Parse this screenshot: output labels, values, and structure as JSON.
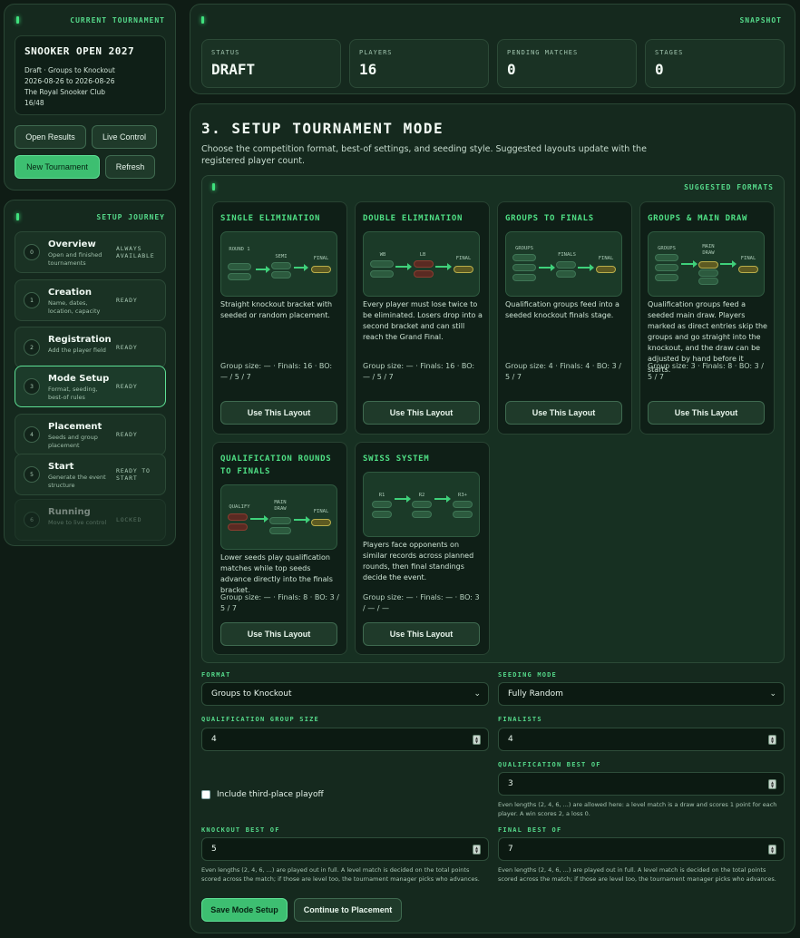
{
  "current": {
    "kicker": "CURRENT TOURNAMENT",
    "name": "SNOOKER OPEN 2027",
    "lines": [
      "Draft · Groups to Knockout",
      "2026-08-26 to 2026-08-26",
      "The Royal Snooker Club",
      "16/48"
    ],
    "buttons": {
      "open": "Open Results",
      "live": "Live Control",
      "new": "New Tournament",
      "refresh": "Refresh"
    }
  },
  "journey": {
    "kicker": "SETUP JOURNEY",
    "steps": [
      {
        "num": "0",
        "name": "Overview",
        "desc": "Open and finished tournaments",
        "status": "ALWAYS AVAILABLE"
      },
      {
        "num": "1",
        "name": "Creation",
        "desc": "Name, dates, location, capacity",
        "status": "READY"
      },
      {
        "num": "2",
        "name": "Registration",
        "desc": "Add the player field",
        "status": "READY"
      },
      {
        "num": "3",
        "name": "Mode Setup",
        "desc": "Format, seeding, best-of rules",
        "status": "READY"
      },
      {
        "num": "4",
        "name": "Placement",
        "desc": "Seeds and group placement",
        "status": "READY"
      },
      {
        "num": "5",
        "name": "Start",
        "desc": "Generate the event structure",
        "status": "READY TO START"
      },
      {
        "num": "6",
        "name": "Running",
        "desc": "Move to live control",
        "status": "LOCKED"
      }
    ]
  },
  "snapshot": {
    "kicker": "SNAPSHOT",
    "stats": [
      {
        "label": "STATUS",
        "value": "DRAFT"
      },
      {
        "label": "PLAYERS",
        "value": "16"
      },
      {
        "label": "PENDING MATCHES",
        "value": "0"
      },
      {
        "label": "STAGES",
        "value": "0"
      }
    ]
  },
  "mode": {
    "title": "3. SETUP TOURNAMENT MODE",
    "intro": "Choose the competition format, best-of settings, and seeding style. Suggested layouts update with the registered player count.",
    "suggested_kicker": "SUGGESTED FORMATS",
    "use_label": "Use This Layout",
    "formats": [
      {
        "title": "SINGLE ELIMINATION",
        "desc": "Straight knockout bracket with seeded or random placement.",
        "meta": "Group size: — · Finals: 16 · BO: — / 5 / 7",
        "d": [
          "ROUND 1",
          "SEMI",
          "FINAL"
        ]
      },
      {
        "title": "DOUBLE ELIMINATION",
        "desc": "Every player must lose twice to be eliminated. Losers drop into a second bracket and can still reach the Grand Final.",
        "meta": "Group size: — · Finals: 16 · BO: — / 5 / 7",
        "d": [
          "WB",
          "LB",
          "FINAL"
        ]
      },
      {
        "title": "GROUPS TO FINALS",
        "desc": "Qualification groups feed into a seeded knockout finals stage.",
        "meta": "Group size: 4 · Finals: 4 · BO: 3 / 5 / 7",
        "d": [
          "GROUPS",
          "FINALS",
          "FINAL"
        ]
      },
      {
        "title": "GROUPS & MAIN DRAW",
        "desc": "Qualification groups feed a seeded main draw. Players marked as direct entries skip the groups and go straight into the knockout, and the draw can be adjusted by hand before it starts.",
        "meta": "Group size: 3 · Finals: 8 · BO: 3 / 5 / 7",
        "d": [
          "GROUPS",
          "MAIN DRAW",
          "FINAL"
        ]
      },
      {
        "title": "QUALIFICATION ROUNDS TO FINALS",
        "desc": "Lower seeds play qualification matches while top seeds advance directly into the finals bracket.",
        "meta": "Group size: — · Finals: 8 · BO: 3 / 5 / 7",
        "d": [
          "QUALIFY",
          "MAIN DRAW",
          "FINAL"
        ]
      },
      {
        "title": "SWISS SYSTEM",
        "desc": "Players face opponents on similar records across planned rounds, then final standings decide the event.",
        "meta": "Group size: — · Finals: — · BO: 3 / — / —",
        "d": [
          "R1",
          "R2",
          "R3+"
        ]
      }
    ]
  },
  "form": {
    "format": {
      "label": "FORMAT",
      "value": "Groups to Knockout"
    },
    "seeding": {
      "label": "SEEDING MODE",
      "value": "Fully Random"
    },
    "qgs": {
      "label": "QUALIFICATION GROUP SIZE",
      "value": "4"
    },
    "finalists": {
      "label": "FINALISTS",
      "value": "4"
    },
    "qbo": {
      "label": "QUALIFICATION BEST OF",
      "value": "3",
      "help": "Even lengths (2, 4, 6, ...) are allowed here: a level match is a draw and scores 1 point for each player. A win scores 2, a loss 0."
    },
    "third": {
      "label": "Include third-place playoff"
    },
    "kbo": {
      "label": "KNOCKOUT BEST OF",
      "value": "5",
      "help": "Even lengths (2, 4, 6, ...) are played out in full. A level match is decided on the total points scored across the match; if those are level too, the tournament manager picks who advances."
    },
    "fbo": {
      "label": "FINAL BEST OF",
      "value": "7",
      "help": "Even lengths (2, 4, 6, ...) are played out in full. A level match is decided on the total points scored across the match; if those are level too, the tournament manager picks who advances."
    },
    "save": "Save Mode Setup",
    "continue": "Continue to Placement"
  }
}
